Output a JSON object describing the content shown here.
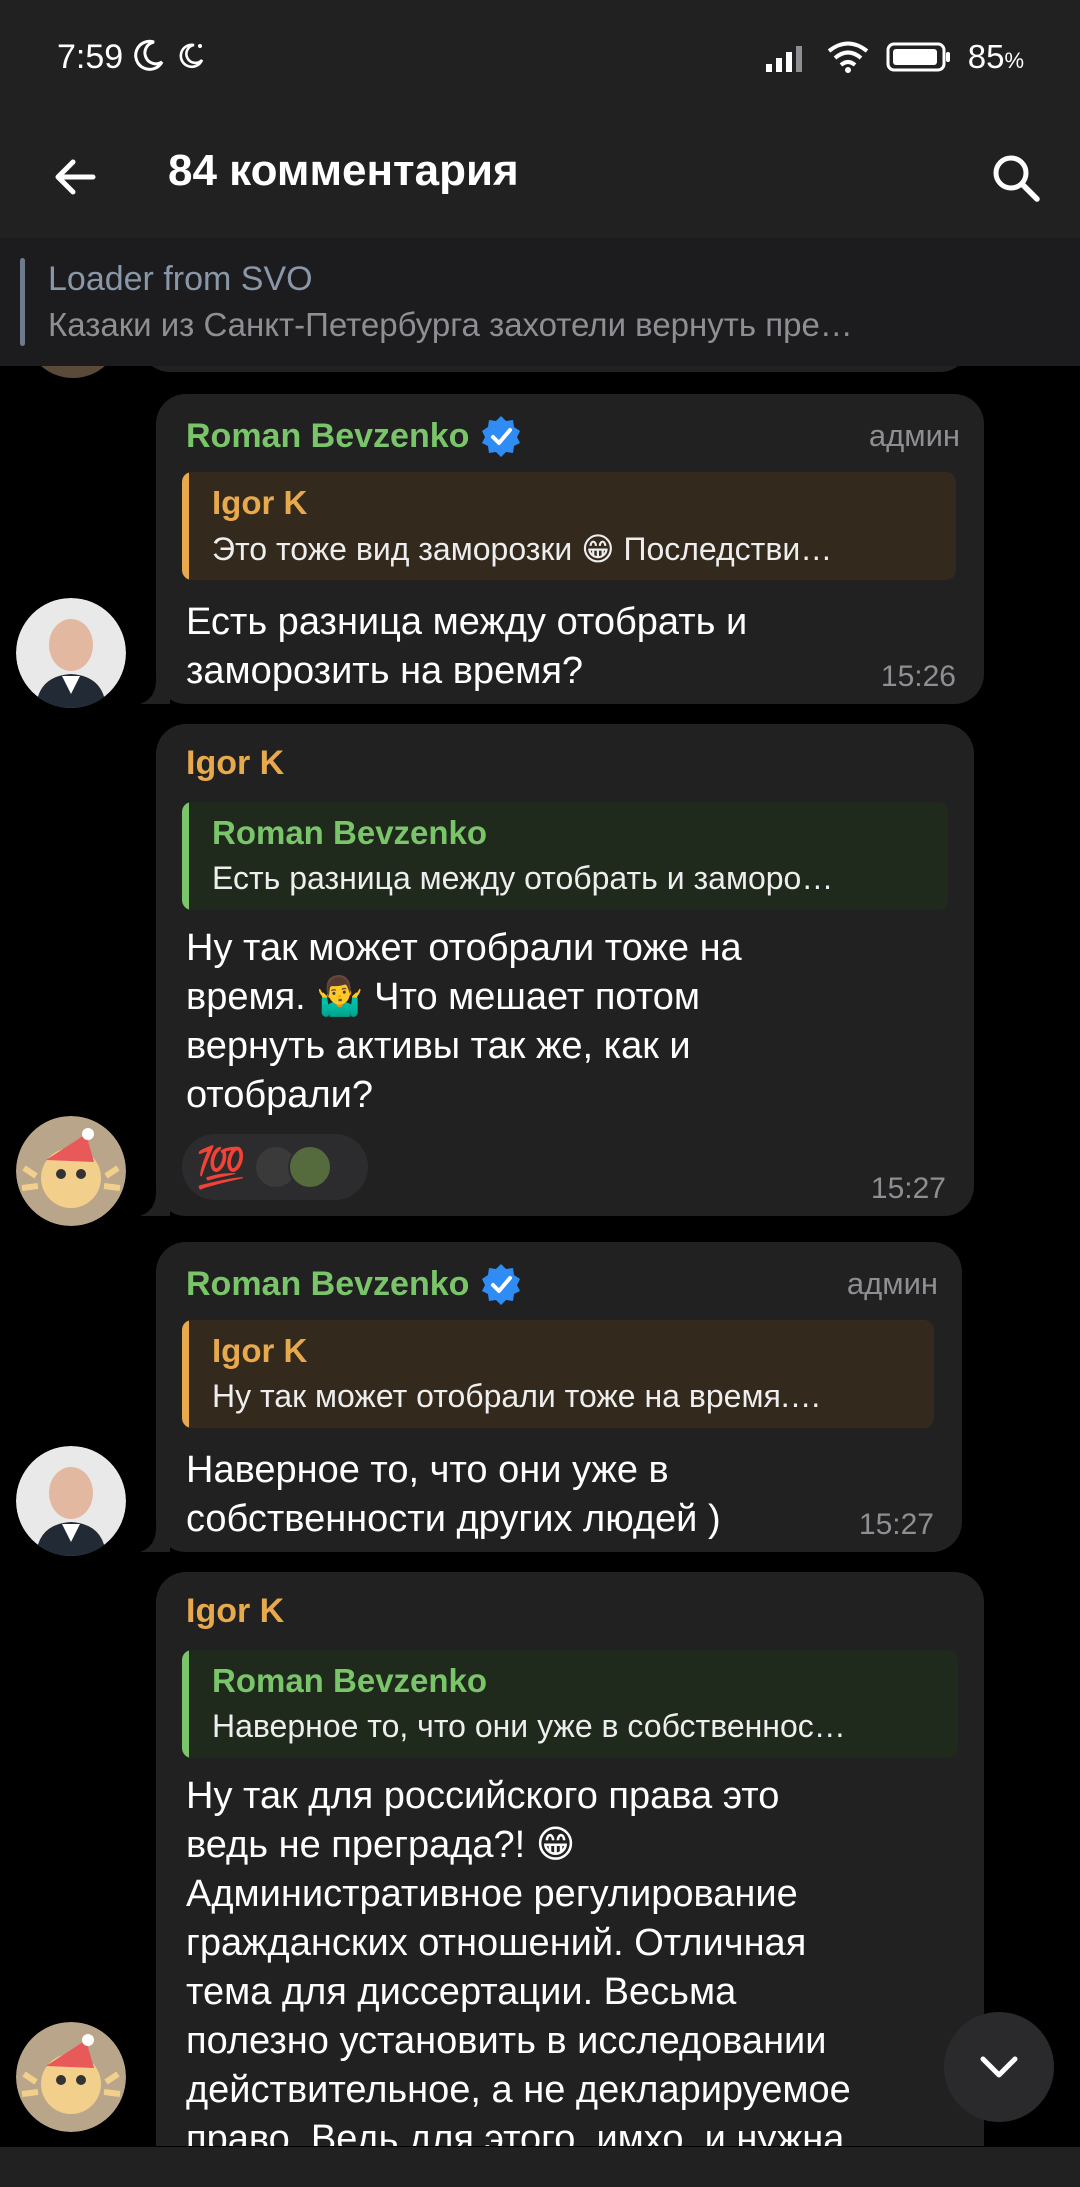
{
  "status_bar": {
    "time": "7:59",
    "battery": "85",
    "battery_unit": "%"
  },
  "header": {
    "title": "84 комментария",
    "back_icon": "arrow-left-icon",
    "search_icon": "search-icon"
  },
  "pinned": {
    "title": "Loader from SVO",
    "text": "Казаки из Санкт-Петербурга захотели вернуть пре…"
  },
  "messages": [
    {
      "sender": "Roman Bevzenko",
      "role": "админ",
      "reply_name": "Igor K",
      "reply_text": "Это тоже вид заморозки 😁 Последстви…",
      "lines": [
        "Есть разница между отобрать и",
        "заморозить на время?"
      ],
      "time": "15:26"
    },
    {
      "sender": "Igor K",
      "reply_name": "Roman Bevzenko",
      "reply_text": "Есть разница между отобрать и заморо…",
      "lines": [
        "Ну так может отобрали тоже на",
        "время. 🤷‍♂️ Что мешает потом",
        "вернуть активы так же, как и",
        "отобрали?"
      ],
      "reaction": "💯",
      "time": "15:27"
    },
    {
      "sender": "Roman Bevzenko",
      "role": "админ",
      "reply_name": "Igor K",
      "reply_text": "Ну так может отобрали тоже на время.…",
      "lines": [
        "Наверное то, что они уже в",
        "собственности других людей )"
      ],
      "time": "15:27"
    },
    {
      "sender": "Igor K",
      "reply_name": "Roman Bevzenko",
      "reply_text": "Наверное то, что они уже в собственнос…",
      "lines": [
        "Ну так для российского права это",
        "ведь не преграда?! 😁",
        "Административное регулирование",
        "гражданских отношений. Отличная",
        "тема для диссертации. Весьма",
        "полезно установить в исследовании",
        "действительное, а не декларируемое",
        "право. Ведь для этого, имхо, и нужна"
      ]
    }
  ],
  "colors": {
    "roman": "#7ac46a",
    "igor": "#e8a84c",
    "bubble": "#212121",
    "verified": "#2f8cf5"
  }
}
